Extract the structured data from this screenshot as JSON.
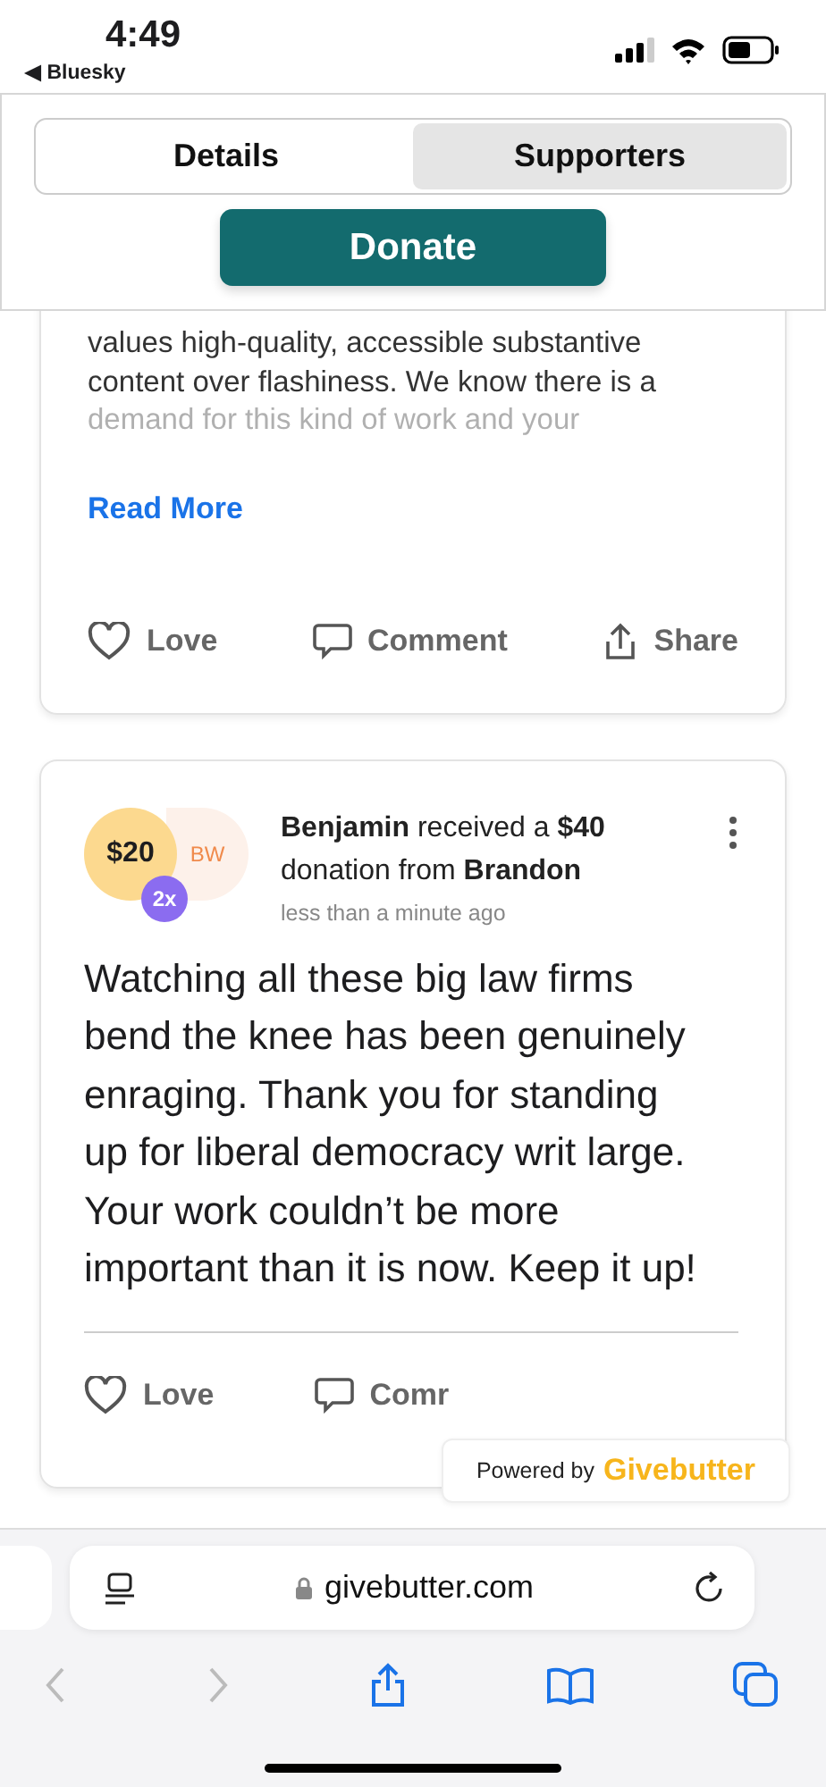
{
  "status_bar": {
    "time": "4:49",
    "back_label": "◀ Bluesky"
  },
  "tabs": [
    {
      "label": "Details",
      "selected": false
    },
    {
      "label": "Supporters",
      "selected": true
    }
  ],
  "donate_button": "Donate",
  "cards": [
    {
      "body_lines": [
        {
          "text": "values high-quality, accessible substantive",
          "faded": false
        },
        {
          "text": "content over flashiness. We know there is a",
          "faded": false
        },
        {
          "text": "demand for this kind of work and your",
          "faded": true
        }
      ],
      "read_more": "Read More",
      "actions": [
        "Love",
        "Comment",
        "Share"
      ]
    },
    {
      "amount": "$20",
      "initials": "BW",
      "multiplier": "2x",
      "headline": "**Benjamin** received a **$40** donation from **Brandon**",
      "time": "less than a minute ago",
      "body": "Watching all these big law firms bend the knee has been genuinely enraging. Thank you for standing up for liberal democracy writ large. Your work couldn’t be more important than it is now. Keep it up!",
      "actions": [
        "Love",
        "Comr"
      ]
    }
  ],
  "badge": {
    "prefix": "Powered by",
    "brand": "Givebutter"
  },
  "browser": {
    "url": "givebutter.com"
  }
}
